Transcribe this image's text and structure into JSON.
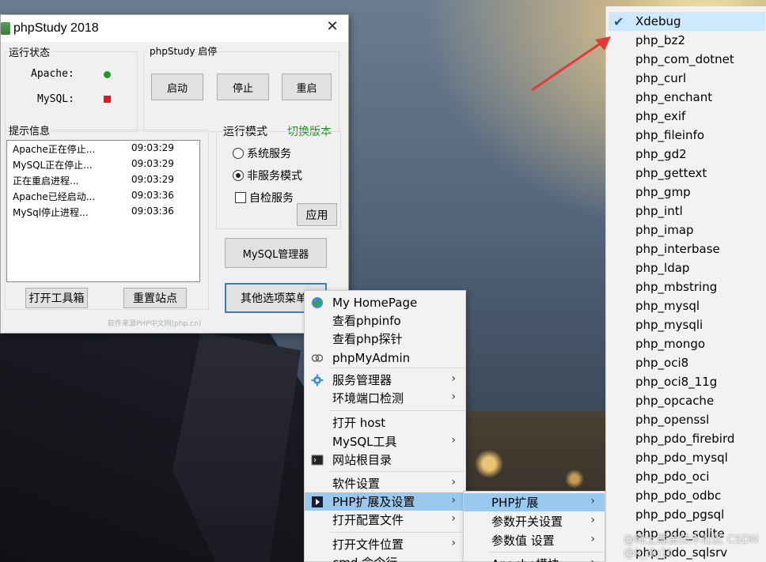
{
  "window": {
    "title": "phpStudy 2018",
    "close_glyph": "✕",
    "status_group": {
      "title": "运行状态",
      "apache_label": "Apache:",
      "mysql_label": "MySQL:",
      "apache_status_color": "#1f9a2a",
      "mysql_status_color": "#e01818"
    },
    "control_group": {
      "title": "phpStudy  启停",
      "start_label": "启动",
      "stop_label": "停止",
      "restart_label": "重启"
    },
    "log_group": {
      "title": "提示信息",
      "entries": [
        {
          "msg": "Apache正在停止...",
          "time": "09:03:29"
        },
        {
          "msg": "MySQL正在停止...",
          "time": "09:03:29"
        },
        {
          "msg": "正在重启进程...",
          "time": "09:03:29"
        },
        {
          "msg": "Apache已经启动...",
          "time": "09:03:36"
        },
        {
          "msg": "MySql停止进程...",
          "time": "09:03:36"
        }
      ]
    },
    "mode_group": {
      "title": "运行模式",
      "switch_version_label": "切换版本",
      "option_service": "系统服务",
      "option_non_service": "非服务模式",
      "selected": "非服务模式",
      "self_check_label": "自检服务",
      "apply_label": "应用"
    },
    "open_toolbox_label": "打开工具箱",
    "reset_site_label": "重置站点",
    "mysql_manager_label": "MySQL管理器",
    "other_options_label": "其他选项菜单",
    "footer_note": "软件来源PHP中文网(php.cn)"
  },
  "menu": {
    "items": [
      {
        "label": "My HomePage",
        "icon": "globe-icon"
      },
      {
        "label": "查看phpinfo"
      },
      {
        "label": "查看php探针"
      },
      {
        "label": "phpMyAdmin",
        "icon": "link-icon"
      },
      {
        "label": "服务管理器",
        "icon": "gear-icon",
        "submenu": true
      },
      {
        "label": "环境端口检测",
        "submenu": true
      },
      {
        "label": "打开 host"
      },
      {
        "label": "MySQL工具",
        "submenu": true
      },
      {
        "label": "网站根目录",
        "icon": "terminal-icon"
      },
      {
        "label": "软件设置",
        "submenu": true
      },
      {
        "label": "PHP扩展及设置",
        "submenu": true,
        "active": true,
        "icon": "play-icon"
      },
      {
        "label": "打开配置文件",
        "submenu": true
      },
      {
        "label": "打开文件位置",
        "submenu": true
      },
      {
        "label": "cmd 命令行"
      }
    ]
  },
  "submenu": {
    "items": [
      {
        "label": "PHP扩展",
        "submenu": true,
        "active": true
      },
      {
        "label": "参数开关设置",
        "submenu": true
      },
      {
        "label": "参数值 设置",
        "submenu": true
      },
      {
        "label": "Apache模块",
        "submenu": true
      }
    ]
  },
  "extensions": {
    "items": [
      {
        "name": "Xdebug",
        "checked": true
      },
      {
        "name": "php_bz2"
      },
      {
        "name": "php_com_dotnet"
      },
      {
        "name": "php_curl"
      },
      {
        "name": "php_enchant"
      },
      {
        "name": "php_exif"
      },
      {
        "name": "php_fileinfo"
      },
      {
        "name": "php_gd2"
      },
      {
        "name": "php_gettext"
      },
      {
        "name": "php_gmp"
      },
      {
        "name": "php_intl"
      },
      {
        "name": "php_imap"
      },
      {
        "name": "php_interbase"
      },
      {
        "name": "php_ldap"
      },
      {
        "name": "php_mbstring"
      },
      {
        "name": "php_mysql"
      },
      {
        "name": "php_mysqli"
      },
      {
        "name": "php_mongo"
      },
      {
        "name": "php_oci8"
      },
      {
        "name": "php_oci8_11g"
      },
      {
        "name": "php_opcache"
      },
      {
        "name": "php_openssl"
      },
      {
        "name": "php_pdo_firebird"
      },
      {
        "name": "php_pdo_mysql"
      },
      {
        "name": "php_pdo_oci"
      },
      {
        "name": "php_pdo_odbc"
      },
      {
        "name": "php_pdo_pgsql"
      },
      {
        "name": "php_pdo_sqlite"
      },
      {
        "name": "php_pdo_sqlsrv"
      }
    ]
  },
  "watermark": "@稀土掘金技术社区 CSDN @k_du1t",
  "colors": {
    "menu_highlight": "#99c9ef",
    "arrow": "#e23a3a",
    "switch_version": "#1a9a1a"
  }
}
